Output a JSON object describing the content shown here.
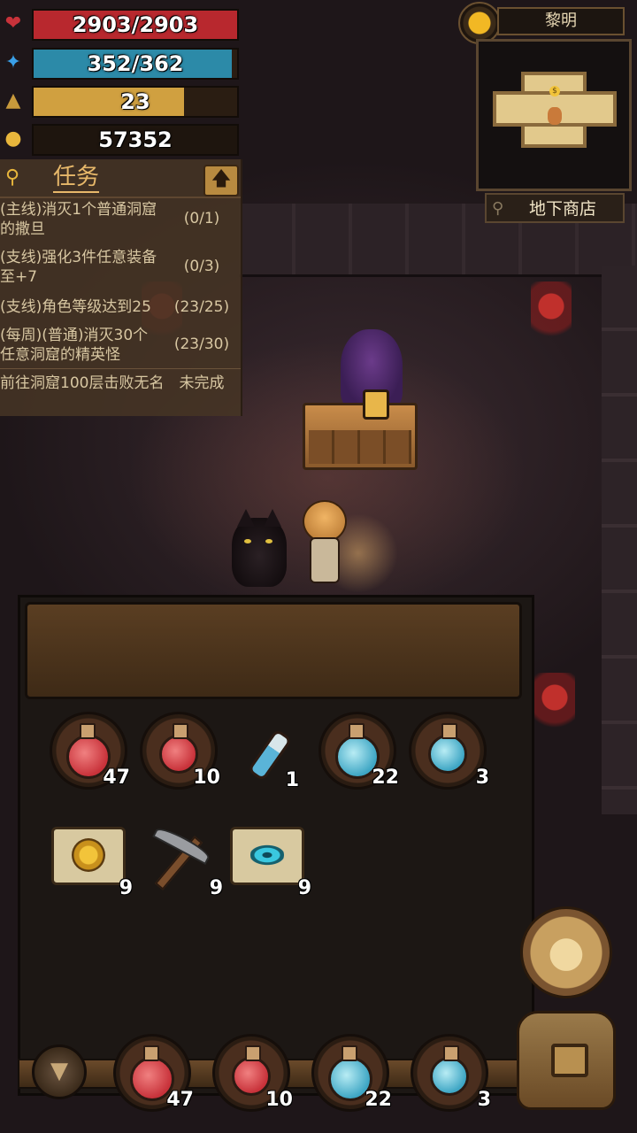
{
  "colors": {
    "hp": "#b8282e",
    "mp": "#2c8aa8",
    "level": "#d0a040",
    "gold_icon": "#e8b63c"
  },
  "stats": {
    "hp": {
      "icon": "heart-icon",
      "value": "2903/2903",
      "fill": 1.0
    },
    "mp": {
      "icon": "magic-wand-icon",
      "value": "352/362",
      "fill": 0.972
    },
    "level": {
      "icon": "triangle-icon",
      "value": "23",
      "fill": 0.74
    },
    "gold": {
      "icon": "gold-nugget-icon",
      "value": "57352"
    }
  },
  "quest_panel": {
    "title": "任务",
    "items": [
      {
        "text": "(主线)消灭1个普通洞窟的撒旦",
        "progress": "(0/1)"
      },
      {
        "text": "(支线)强化3件任意装备至+7",
        "progress": "(0/3)"
      },
      {
        "text": "(支线)角色等级达到25",
        "progress": "(23/25)"
      },
      {
        "text": "(每周)(普通)消灭30个任意洞窟的精英怪",
        "progress": "(23/30)"
      },
      {
        "text": "前往洞窟100层击败无名",
        "progress": "未完成"
      }
    ]
  },
  "minimap": {
    "time_of_day": "黎明",
    "location": "地下商店"
  },
  "inventory": {
    "row1": [
      {
        "icon": "red-potion-large-icon",
        "count": "47"
      },
      {
        "icon": "red-potion-icon",
        "count": "10"
      },
      {
        "icon": "blue-vial-icon",
        "count": "1"
      },
      {
        "icon": "blue-potion-large-icon",
        "count": "22"
      },
      {
        "icon": "blue-potion-icon",
        "count": "3"
      }
    ],
    "row2": [
      {
        "icon": "gold-scroll-icon",
        "count": "9"
      },
      {
        "icon": "pickaxe-icon",
        "count": "9"
      },
      {
        "icon": "blue-eye-scroll-icon",
        "count": "9"
      }
    ]
  },
  "quickbar": [
    {
      "icon": "red-potion-large-icon",
      "count": "47"
    },
    {
      "icon": "red-potion-icon",
      "count": "10"
    },
    {
      "icon": "blue-potion-large-icon",
      "count": "22"
    },
    {
      "icon": "blue-potion-icon",
      "count": "3"
    }
  ]
}
